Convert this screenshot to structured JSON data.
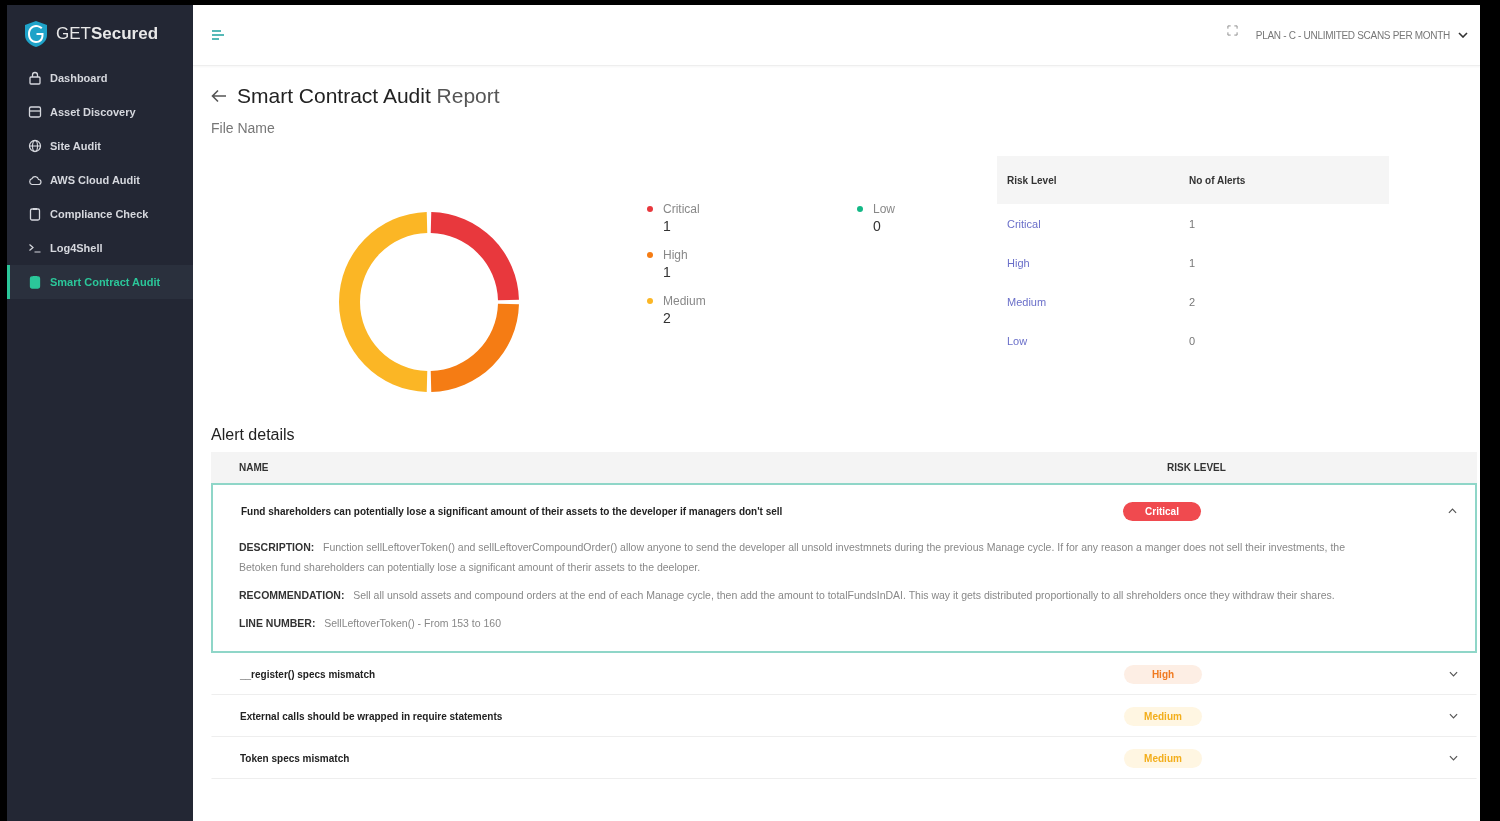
{
  "brand": {
    "prefix": "GET",
    "name": "Secured"
  },
  "sidebar": {
    "items": [
      {
        "label": "Dashboard",
        "selected": false
      },
      {
        "label": "Asset Discovery",
        "selected": false
      },
      {
        "label": "Site Audit",
        "selected": false
      },
      {
        "label": "AWS Cloud Audit",
        "selected": false
      },
      {
        "label": "Compliance Check",
        "selected": false
      },
      {
        "label": "Log4Shell",
        "selected": false
      },
      {
        "label": "Smart Contract Audit",
        "selected": true
      }
    ]
  },
  "topbar": {
    "plan": "PLAN - C - UNLIMITED SCANS PER MONTH"
  },
  "page": {
    "title": "Smart Contract Audit",
    "title_suffix": "Report",
    "subtitle": "File Name"
  },
  "risk_chart": {
    "chart_data": {
      "type": "donut",
      "categories": [
        "Critical",
        "High",
        "Medium",
        "Low"
      ],
      "values": [
        25,
        25,
        50,
        0
      ]
    }
  },
  "legend": [
    {
      "value": "1",
      "color": "#e8383d"
    },
    {
      "value": "1",
      "color": "#f57c14"
    },
    {
      "value": "2",
      "color": "#fbb625"
    },
    {
      "value": "0",
      "color": "#13b886"
    }
  ],
  "risk_table": {
    "columns": [
      "Risk Level",
      "No of Alerts"
    ],
    "rows": [
      {
        "level": "Critical",
        "count": "1"
      },
      {
        "level": "High",
        "count": "1"
      },
      {
        "level": "Medium",
        "count": "2"
      },
      {
        "level": "Low",
        "count": "0"
      }
    ]
  },
  "alerts": {
    "title": "Alert details",
    "columns": [
      "NAME",
      "RISK LEVEL"
    ],
    "rows": [
      {
        "name": "Fund shareholders can potentially lose a significant amount of their assets to the developer if managers don't sell",
        "risk": "Critical",
        "kind": "critical",
        "expanded": true,
        "details": [
          {
            "label": "DESCRIPTION:",
            "text": "Function sellLeftoverToken() and sellLeftoverCompoundOrder() allow anyone to send the developer all unsold investmnets during the previous Manage cycle. If for any reason a manger does not sell their investments, the Betoken fund shareholders can potentially lose a significant amount of therir assets to the deeloper."
          },
          {
            "label": "RECOMMENDATION:",
            "text": "Sell all unsold assets and compound orders at the end of each Manage cycle, then add the amount to totalFundsInDAI. This way it gets distributed proportionally to all shreholders once they withdraw their shares."
          },
          {
            "label": "LINE NUMBER:",
            "text": "SellLeftoverToken() - From 153 to 160"
          }
        ]
      },
      {
        "name": "__register() specs mismatch",
        "risk": "High",
        "kind": "high",
        "expanded": false
      },
      {
        "name": "External calls should be wrapped in require statements",
        "risk": "Medium",
        "kind": "medium",
        "expanded": false
      },
      {
        "name": "Token specs mismatch",
        "risk": "Medium",
        "kind": "medium",
        "expanded": false
      }
    ]
  }
}
